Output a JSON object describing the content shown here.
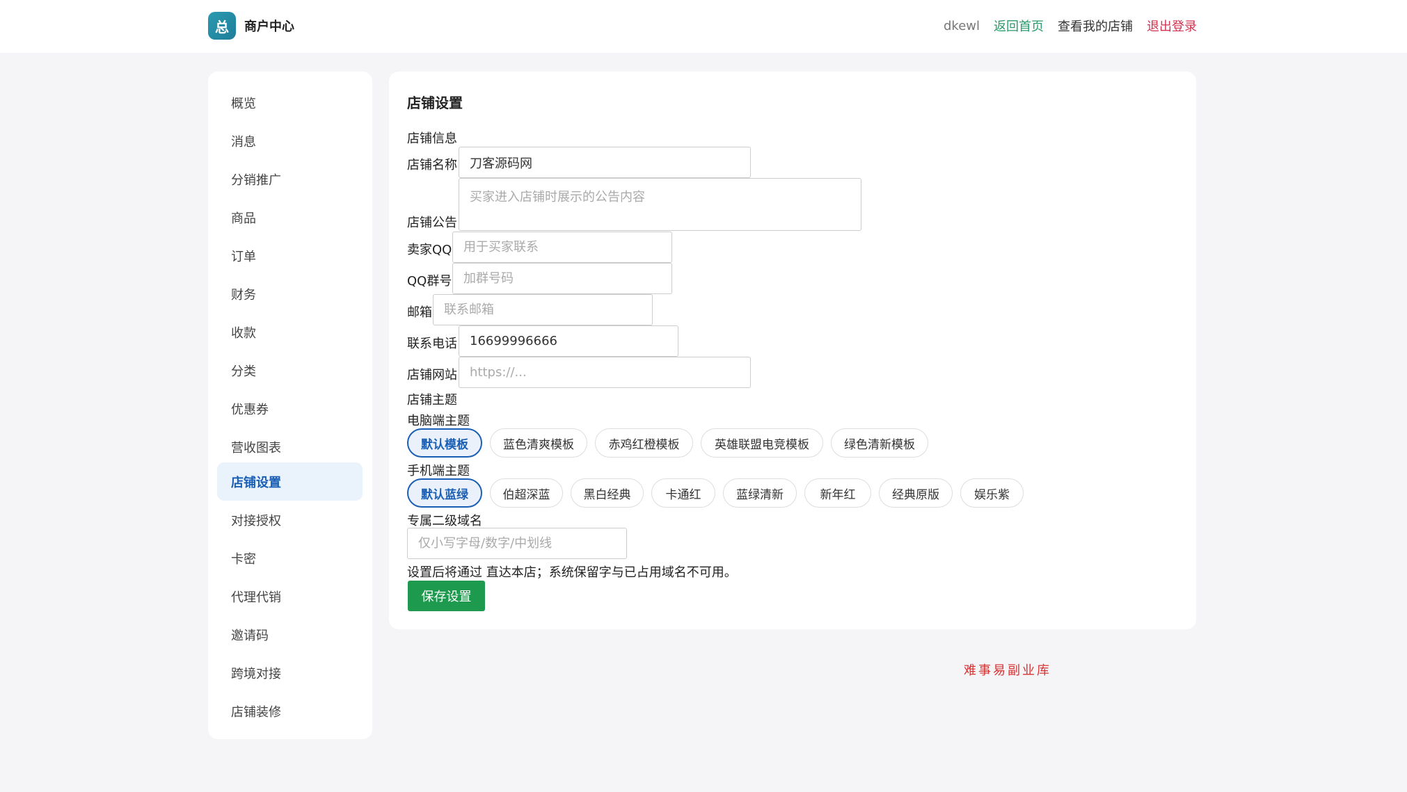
{
  "header": {
    "brand_icon": "总",
    "brand_title": "商户中心",
    "user": "dkewl",
    "home_link": "返回首页",
    "store_link": "查看我的店铺",
    "logout_link": "退出登录"
  },
  "sidebar": {
    "items": [
      {
        "label": "概览"
      },
      {
        "label": "消息"
      },
      {
        "label": "分销推广"
      },
      {
        "label": "商品"
      },
      {
        "label": "订单"
      },
      {
        "label": "财务"
      },
      {
        "label": "收款"
      },
      {
        "label": "分类"
      },
      {
        "label": "优惠券"
      },
      {
        "label": "营收图表"
      },
      {
        "label": "店铺设置"
      },
      {
        "label": "对接授权"
      },
      {
        "label": "卡密"
      },
      {
        "label": "代理代销"
      },
      {
        "label": "邀请码"
      },
      {
        "label": "跨境对接"
      },
      {
        "label": "店铺装修"
      }
    ],
    "active": "店铺设置"
  },
  "form": {
    "title": "店铺设置",
    "section_info": "店铺信息",
    "store_name": {
      "label": "店铺名称",
      "value": "刀客源码网"
    },
    "notice": {
      "label": "店铺公告",
      "placeholder": "买家进入店铺时展示的公告内容"
    },
    "qq": {
      "label": "卖家QQ",
      "placeholder": "用于买家联系"
    },
    "qq_group": {
      "label": "QQ群号",
      "placeholder": "加群号码"
    },
    "email": {
      "label": "邮箱",
      "placeholder": "联系邮箱"
    },
    "phone": {
      "label": "联系电话",
      "value": "16699996666"
    },
    "website": {
      "label": "店铺网站",
      "placeholder": "https://..."
    },
    "section_theme": "店铺主题",
    "pc_theme_label": "电脑端主题",
    "pc_themes": [
      "默认模板",
      "蓝色清爽模板",
      "赤鸡红橙模板",
      "英雄联盟电竞模板",
      "绿色清新模板"
    ],
    "pc_selected": "默认模板",
    "mobile_theme_label": "手机端主题",
    "mobile_themes": [
      "默认蓝绿",
      "伯超深蓝",
      "黑白经典",
      "卡通红",
      "蓝绿清新",
      "新年红",
      "经典原版",
      "娱乐紫"
    ],
    "mobile_selected": "默认蓝绿",
    "subdomain": {
      "label": "专属二级域名",
      "placeholder": "仅小写字母/数字/中划线"
    },
    "subdomain_hint": "设置后将通过 直达本店；系统保留字与已占用域名不可用。",
    "save_label": "保存设置"
  },
  "watermark": "难事易副业库",
  "colors": {
    "accent_blue": "#1a5fb4",
    "save_green": "#1e9a4f",
    "logout_red": "#d0324f",
    "home_green": "#2a9a6a"
  }
}
